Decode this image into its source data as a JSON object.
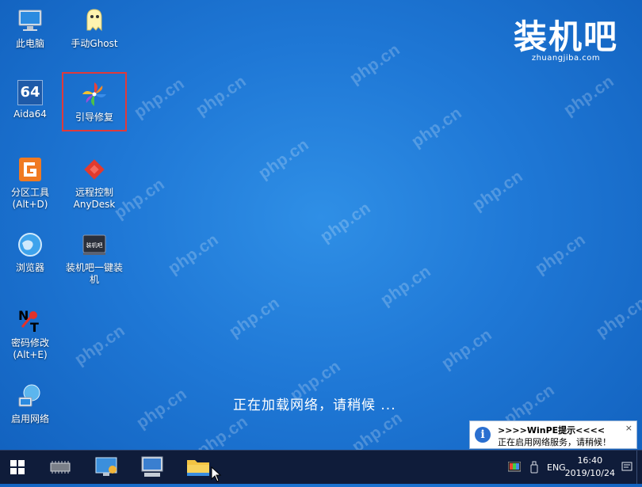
{
  "desktop": {
    "watermark_text": "php.cn",
    "icons": [
      {
        "label": "此电脑",
        "icon": "computer-icon"
      },
      {
        "label": "手动Ghost",
        "icon": "ghost-icon"
      },
      {
        "label": "Aida64",
        "icon": "aida64-icon"
      },
      {
        "label": "引导修复",
        "icon": "pinwheel-icon"
      },
      {
        "label": "分区工具(Alt+D)",
        "icon": "partition-tool-icon"
      },
      {
        "label": "远程控制AnyDesk",
        "icon": "anydesk-icon"
      },
      {
        "label": "浏览器",
        "icon": "browser-globe-icon"
      },
      {
        "label": "装机吧一键装机",
        "icon": "zhuangjiba-installer-icon"
      },
      {
        "label": "密码修改(Alt+E)",
        "icon": "password-reset-icon"
      },
      {
        "label": "启用网络",
        "icon": "network-globe-icon"
      }
    ],
    "icon_labels": {
      "pc": "此电脑",
      "ghost": "手动Ghost",
      "aida": "Aida64",
      "boot_repair": "引导修复",
      "partition_l1": "分区工具",
      "partition_l2": "(Alt+D)",
      "anydesk_l1": "远程控制",
      "anydesk_l2": "AnyDesk",
      "browser": "浏览器",
      "installer_l1": "装机吧一键装",
      "installer_l2": "机",
      "password_l1": "密码修改",
      "password_l2": "(Alt+E)",
      "network": "启用网络"
    },
    "aida_badge": "64",
    "installer_badge": "装机吧",
    "brand": {
      "name": "装机吧",
      "domain": "zhuangjiba.com"
    },
    "loading_text": "正在加载网络，请稍候 ..."
  },
  "notification": {
    "title": ">>>>WinPE提示<<<<",
    "message": "正在启用网络服务，请稍候！",
    "close": "×"
  },
  "taskbar": {
    "language": "ENG",
    "time": "16:40",
    "date": "2019/10/24"
  },
  "colors": {
    "desktop_blue": "#1f78d6",
    "taskbar": "#0f1c3a",
    "selection_border": "#e03a3a",
    "info_blue": "#2a6fd0"
  }
}
